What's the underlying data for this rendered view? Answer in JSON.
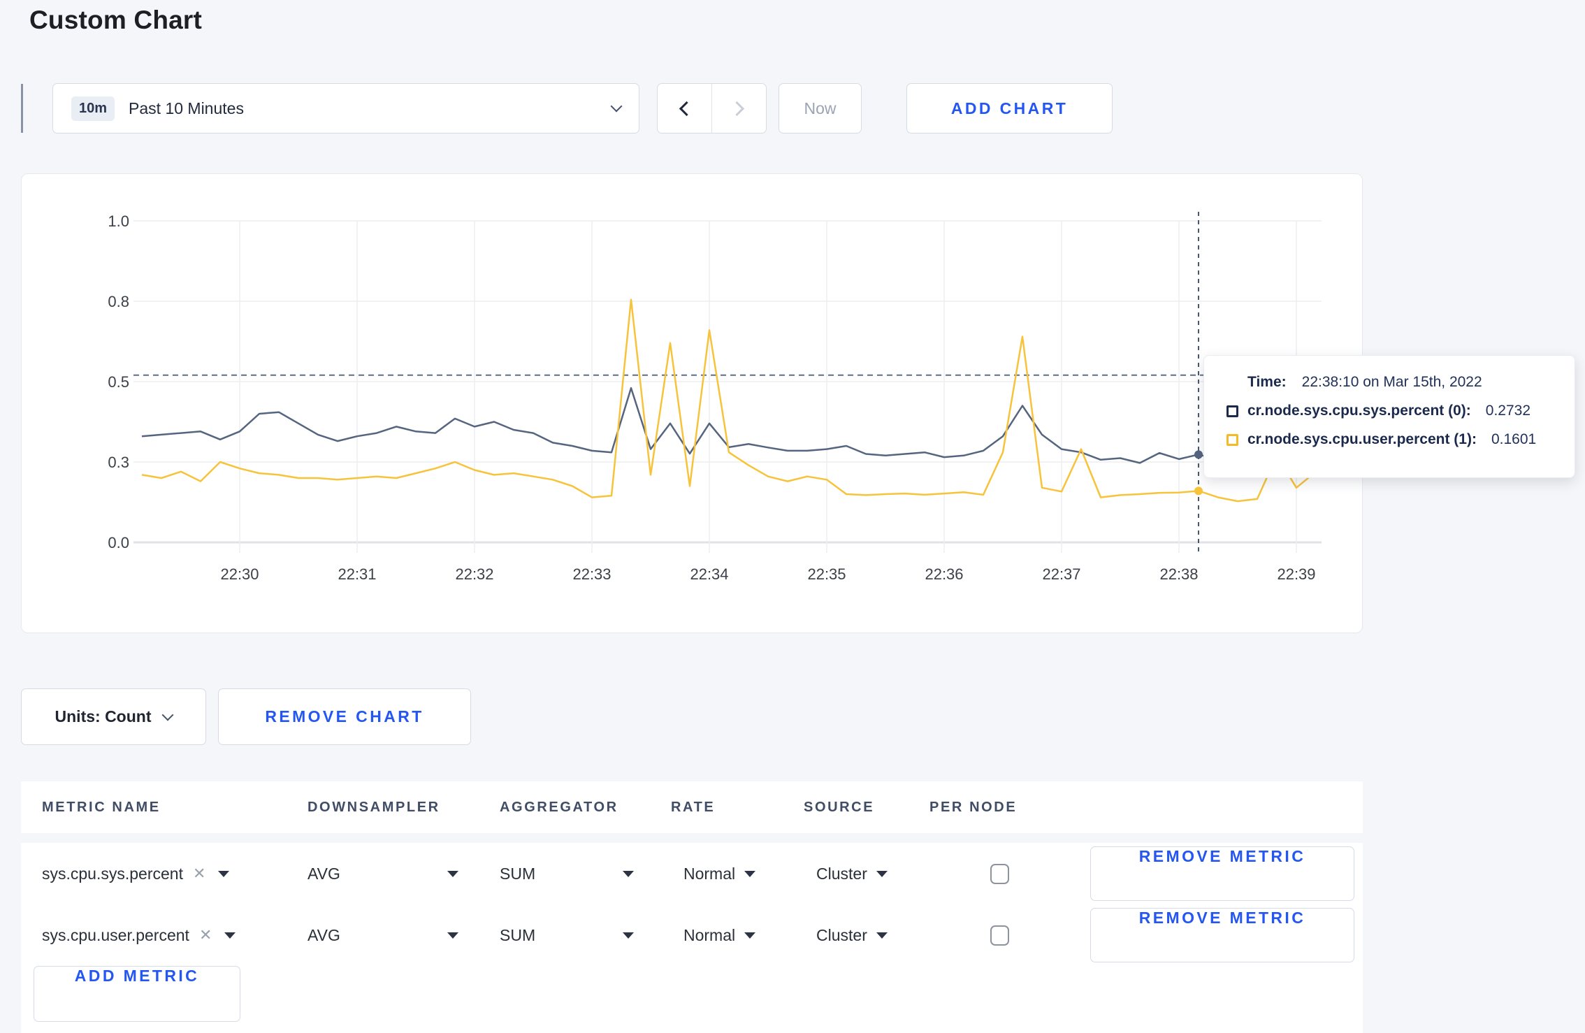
{
  "page": {
    "title": "Custom Chart",
    "accent_blue": "#2457f2",
    "background": "#f4f6f9"
  },
  "toolbar": {
    "range_badge": "10m",
    "range_label": "Past 10 Minutes",
    "now_label": "Now",
    "add_chart_label": "ADD CHART"
  },
  "tooltip": {
    "time_label": "Time:",
    "time_value": "22:38:10 on Mar 15th, 2022",
    "rows": [
      {
        "label": "cr.node.sys.cpu.sys.percent (0):",
        "value": "0.2732",
        "color": "#1b2b4d"
      },
      {
        "label": "cr.node.sys.cpu.user.percent (1):",
        "value": "0.1601",
        "color": "#f2bb29"
      }
    ]
  },
  "chart_actions": {
    "units_label": "Units: Count",
    "remove_chart_label": "REMOVE CHART"
  },
  "metrics_table": {
    "columns": [
      "METRIC NAME",
      "DOWNSAMPLER",
      "AGGREGATOR",
      "RATE",
      "SOURCE",
      "PER NODE"
    ],
    "rows": [
      {
        "metric": "sys.cpu.sys.percent",
        "downsampler": "AVG",
        "aggregator": "SUM",
        "rate": "Normal",
        "source": "Cluster",
        "per_node": false,
        "remove_label": "REMOVE METRIC"
      },
      {
        "metric": "sys.cpu.user.percent",
        "downsampler": "AVG",
        "aggregator": "SUM",
        "rate": "Normal",
        "source": "Cluster",
        "per_node": false,
        "remove_label": "REMOVE METRIC"
      }
    ],
    "add_metric_label": "ADD METRIC"
  },
  "chart_data": {
    "type": "line",
    "title": "",
    "xlabel": "",
    "ylabel": "",
    "ylim": [
      0,
      1
    ],
    "grid": true,
    "legend_position": "none",
    "x_ticks": [
      "22:30",
      "22:31",
      "22:32",
      "22:33",
      "22:34",
      "22:35",
      "22:36",
      "22:37",
      "22:38",
      "22:39"
    ],
    "y_ticks": [
      {
        "label": "0.0",
        "value": 0
      },
      {
        "label": "0.3",
        "value": 0.25
      },
      {
        "label": "0.5",
        "value": 0.5
      },
      {
        "label": "0.8",
        "value": 0.75
      },
      {
        "label": "1.0",
        "value": 1
      }
    ],
    "start_time": "22:29:10",
    "interval_seconds": 10,
    "guide_value": 0.52,
    "crosshair": {
      "time": "22:38:10",
      "index": 54
    },
    "series": [
      {
        "name": "cr.node.sys.cpu.sys.percent",
        "color": "#55657f",
        "values": [
          0.33,
          0.335,
          0.34,
          0.345,
          0.32,
          0.345,
          0.4,
          0.405,
          0.37,
          0.335,
          0.315,
          0.33,
          0.34,
          0.36,
          0.345,
          0.34,
          0.385,
          0.36,
          0.375,
          0.35,
          0.34,
          0.31,
          0.3,
          0.285,
          0.28,
          0.48,
          0.29,
          0.37,
          0.276,
          0.37,
          0.296,
          0.306,
          0.295,
          0.285,
          0.285,
          0.29,
          0.3,
          0.275,
          0.27,
          0.275,
          0.28,
          0.265,
          0.27,
          0.285,
          0.33,
          0.425,
          0.335,
          0.29,
          0.28,
          0.257,
          0.262,
          0.247,
          0.278,
          0.259,
          0.2732,
          0.258,
          0.27,
          0.3,
          0.305,
          0.298,
          0.305
        ]
      },
      {
        "name": "cr.node.sys.cpu.user.percent",
        "color": "#f7c33b",
        "values": [
          0.21,
          0.2,
          0.22,
          0.19,
          0.25,
          0.23,
          0.215,
          0.21,
          0.2,
          0.2,
          0.195,
          0.2,
          0.205,
          0.2,
          0.215,
          0.23,
          0.25,
          0.225,
          0.21,
          0.215,
          0.205,
          0.195,
          0.175,
          0.14,
          0.145,
          0.755,
          0.21,
          0.62,
          0.175,
          0.66,
          0.28,
          0.24,
          0.205,
          0.19,
          0.205,
          0.195,
          0.15,
          0.147,
          0.15,
          0.152,
          0.148,
          0.152,
          0.156,
          0.148,
          0.28,
          0.64,
          0.17,
          0.158,
          0.29,
          0.14,
          0.147,
          0.15,
          0.154,
          0.155,
          0.1601,
          0.14,
          0.128,
          0.135,
          0.27,
          0.17,
          0.22
        ]
      }
    ]
  }
}
